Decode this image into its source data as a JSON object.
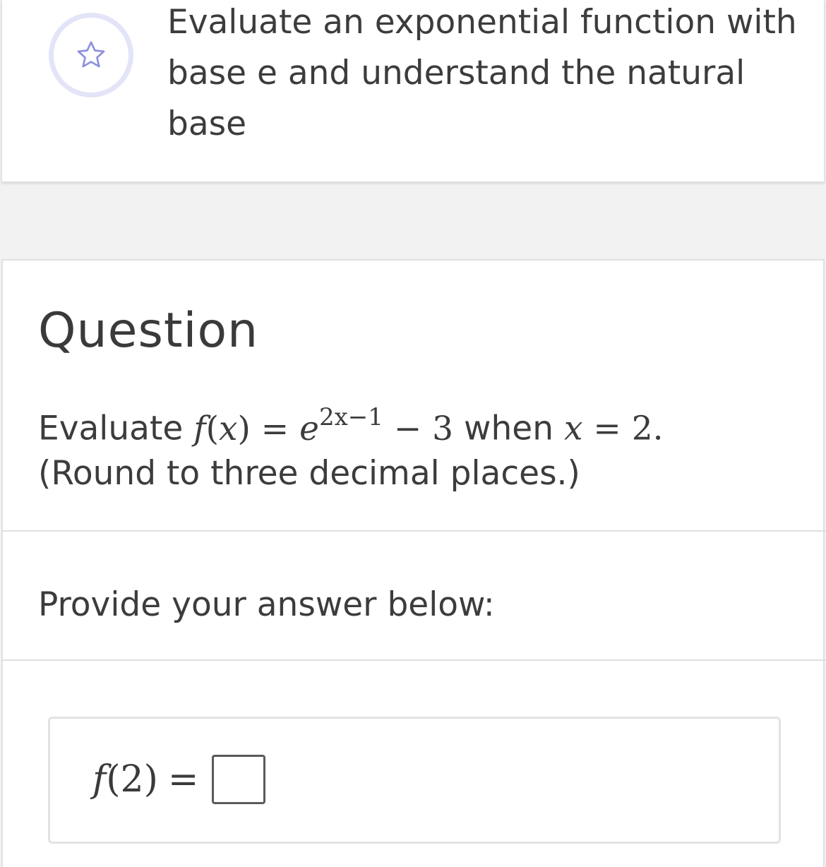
{
  "objective": {
    "icon": "star-icon",
    "text": "Evaluate an exponential function with base e and understand the natural base"
  },
  "question": {
    "heading": "Question",
    "prompt_prefix": "Evaluate",
    "function_name": "f",
    "function_var": "x",
    "base": "e",
    "exponent": "2x−1",
    "minus_term": "− 3",
    "when_text": "when",
    "condition_var": "x",
    "condition_value": "= 2.",
    "instruction": "(Round to three decimal places.)"
  },
  "answer": {
    "prompt": "Provide your answer below:",
    "lhs_function": "f",
    "lhs_arg": "(2)",
    "equals": "=",
    "value": "",
    "placeholder": ""
  },
  "colors": {
    "badge_ring": "#e3e4f8",
    "star_outline": "#8f90de",
    "text": "#3c3c3c",
    "divider": "#e0e0e0"
  }
}
